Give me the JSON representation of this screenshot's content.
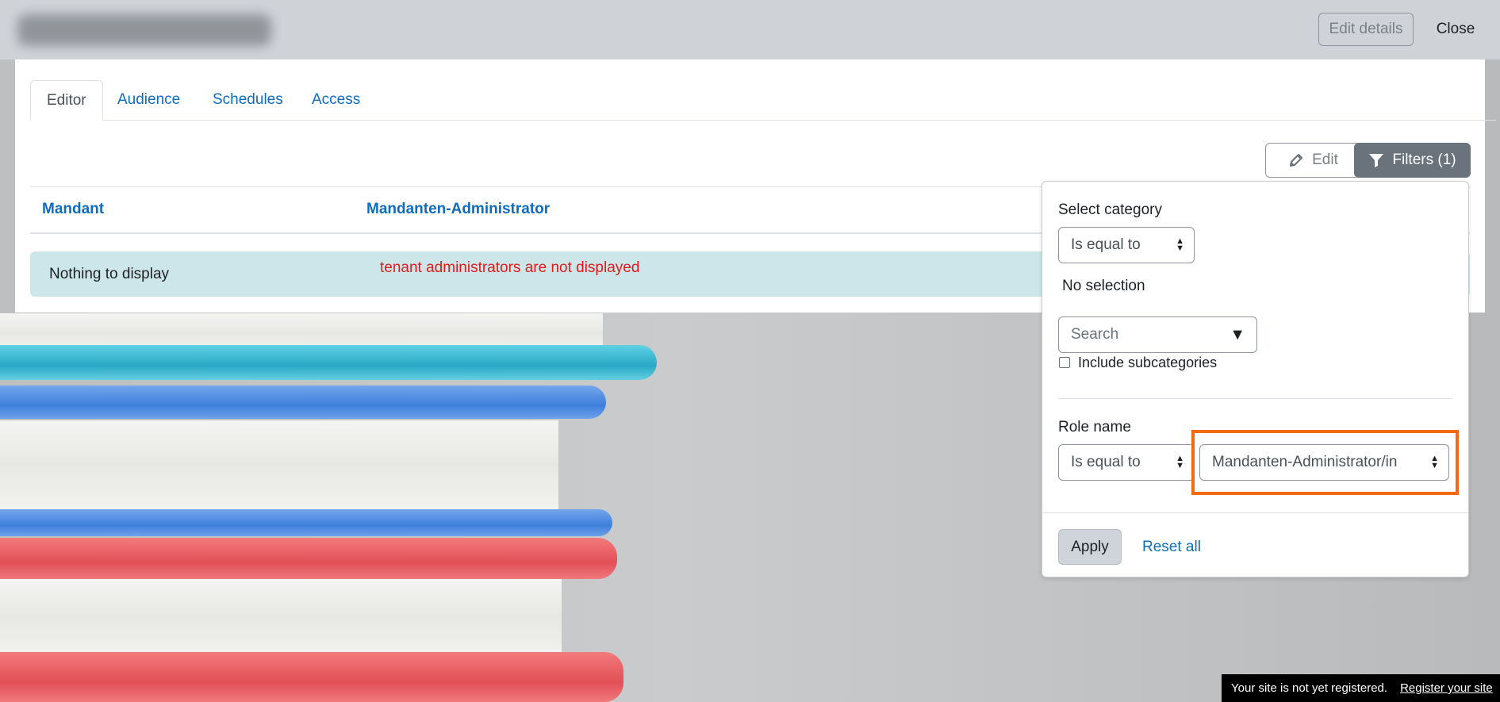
{
  "header": {
    "edit_details_label": "Edit details",
    "close_label": "Close"
  },
  "tabs": [
    {
      "label": "Editor",
      "active": true
    },
    {
      "label": "Audience",
      "active": false
    },
    {
      "label": "Schedules",
      "active": false
    },
    {
      "label": "Access",
      "active": false
    }
  ],
  "toolbar": {
    "edit_label": "Edit",
    "filters_label": "Filters (1)"
  },
  "table": {
    "columns": [
      "Mandant",
      "Mandanten-Administrator"
    ],
    "empty_message": "Nothing to display"
  },
  "annotation_text": "tenant administrators are not displayed",
  "filters": {
    "category": {
      "label": "Select category",
      "operator": "Is equal to",
      "selection_text": "No selection",
      "search_placeholder": "Search",
      "include_subcategories_label": "Include subcategories",
      "include_subcategories_checked": false
    },
    "role": {
      "label": "Role name",
      "operator": "Is equal to",
      "value": "Mandanten-Administrator/in"
    },
    "apply_label": "Apply",
    "reset_label": "Reset all"
  },
  "registration": {
    "message": "Your site is not yet registered.",
    "link_label": "Register your site"
  },
  "colors": {
    "link": "#0f6cbf",
    "filters_button": "#6a737b",
    "alert_bg": "#cce6ea",
    "annotation": "#e31b1b",
    "highlight_border": "#f26b10"
  }
}
